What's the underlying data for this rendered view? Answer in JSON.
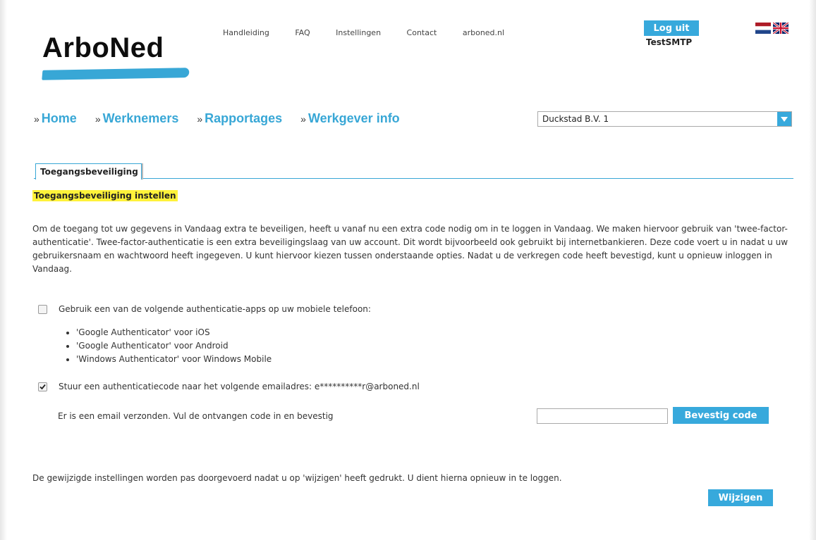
{
  "brand": {
    "logo_text": "ArboNed",
    "accent": "#37a9dc",
    "highlight": "#fff23a"
  },
  "top_nav": [
    "Handleiding",
    "FAQ",
    "Instellingen",
    "Contact",
    "arboned.nl"
  ],
  "user": {
    "logout_label": "Log uit",
    "username": "TestSMTP"
  },
  "languages": [
    {
      "code": "nl",
      "icon": "flag-nl-icon"
    },
    {
      "code": "en",
      "icon": "flag-uk-icon"
    }
  ],
  "main_nav": {
    "prefix": "»",
    "items": [
      "Home",
      "Werknemers",
      "Rapportages",
      "Werkgever info"
    ]
  },
  "company_select": {
    "value": "Duckstad B.V. 1"
  },
  "tab": {
    "label": "Toegangsbeveiliging"
  },
  "section": {
    "title": "Toegangsbeveiliging instellen"
  },
  "intro": "Om de toegang tot uw gegevens in Vandaag extra te beveiligen, heeft u vanaf nu een extra code nodig om in te loggen in Vandaag. We maken hiervoor gebruik van 'twee-factor-authenticatie'. Twee-factor-authenticatie is een extra beveiligingslaag van uw account. Dit wordt bijvoorbeeld ook gebruikt bij internetbankieren. Deze code voert u in nadat u uw gebruikersnaam en wachtwoord heeft ingegeven. U kunt hiervoor kiezen tussen onderstaande opties. Nadat u de verkregen code heeft bevestigd, kunt u opnieuw inloggen in Vandaag.",
  "options": {
    "app": {
      "label": "Gebruik een van de volgende authenticatie-apps op uw mobiele telefoon:",
      "checked": false,
      "apps": [
        "'Google Authenticator' voor iOS",
        "'Google Authenticator' voor Android",
        "'Windows Authenticator' voor Windows Mobile"
      ]
    },
    "email": {
      "label": "Stuur een authenticatiecode naar het volgende emailadres: e**********r@arboned.nl",
      "checked": true,
      "sent_text": "Er is een email verzonden. Vul de ontvangen code in en bevestig",
      "code_value": "",
      "confirm_label": "Bevestig code"
    }
  },
  "footer_note": "De gewijzigde instellingen worden pas doorgevoerd nadat u op 'wijzigen' heeft gedrukt. U dient hierna opnieuw in te loggen.",
  "submit_label": "Wijzigen"
}
